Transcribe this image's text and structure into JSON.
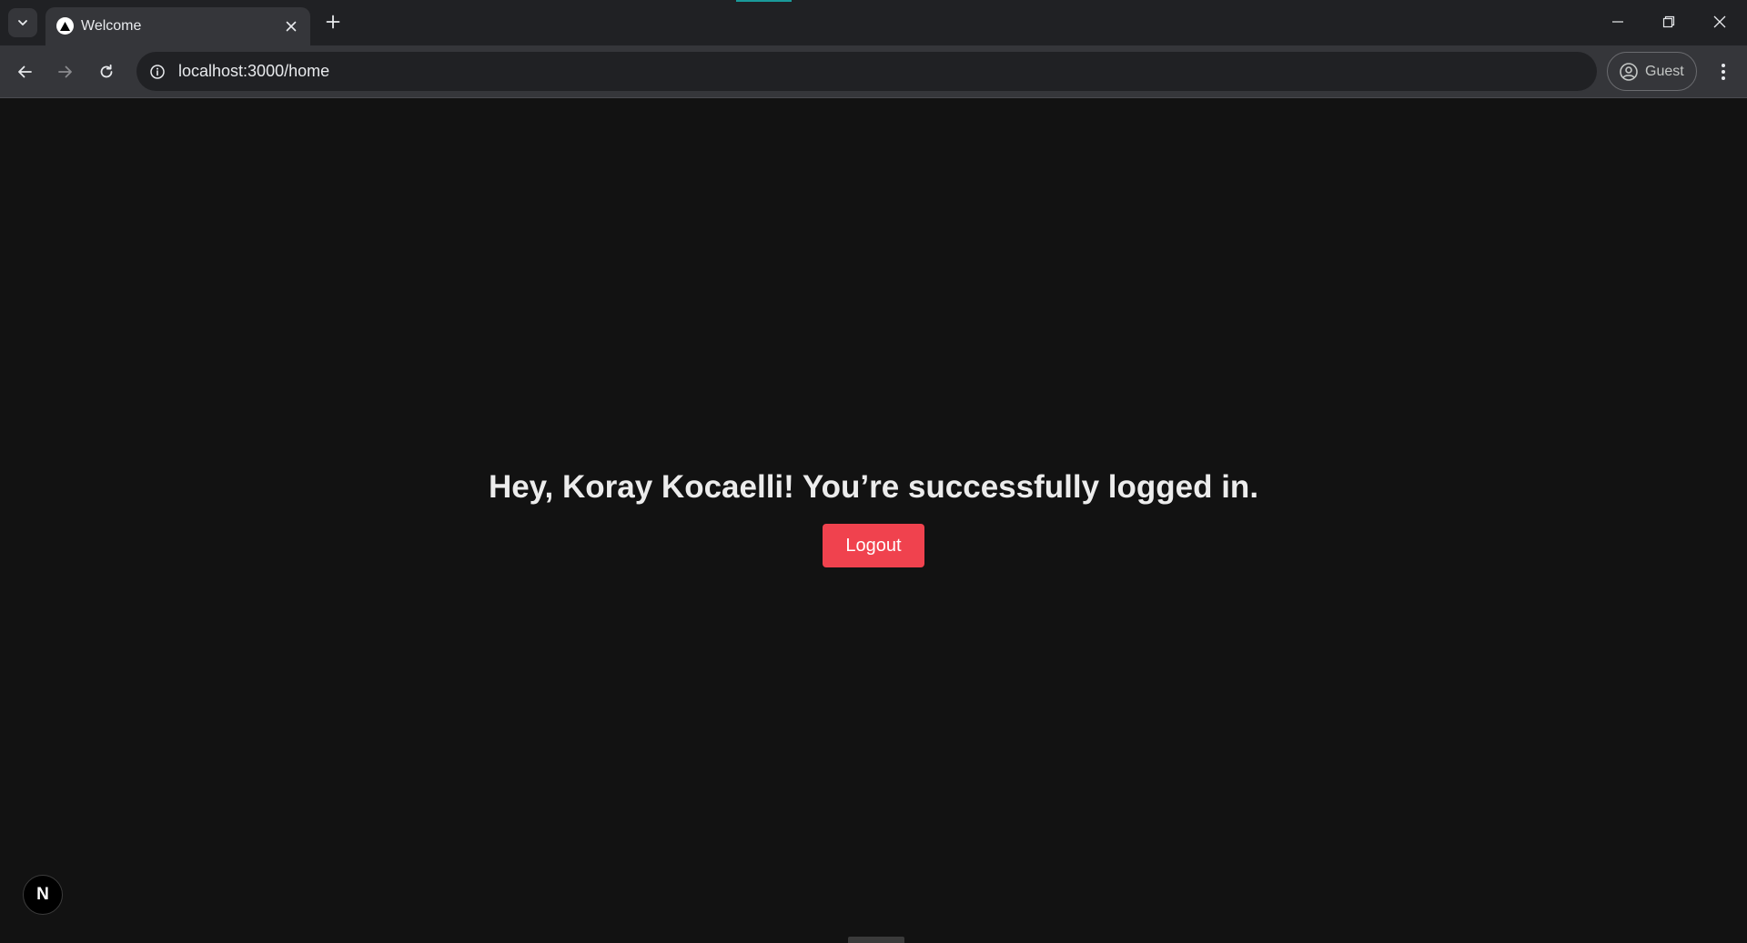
{
  "browser": {
    "tab": {
      "title": "Welcome",
      "favicon": "triangle-icon"
    },
    "address_bar": {
      "url": "localhost:3000/home"
    },
    "profile": {
      "label": "Guest"
    },
    "icons": {
      "tab_search": "chevron-down-icon",
      "tab_close": "close-icon",
      "new_tab": "plus-icon",
      "back": "arrow-left-icon",
      "forward": "arrow-right-icon",
      "reload": "reload-icon",
      "site_info": "info-icon",
      "profile": "user-circle-icon",
      "menu": "kebab-menu-icon",
      "minimize": "minimize-icon",
      "restore": "restore-icon",
      "close_window": "close-icon"
    }
  },
  "page": {
    "greeting": "Hey, Koray Kocaelli! You’re successfully logged in.",
    "logout_label": "Logout",
    "dev_badge": "N"
  },
  "colors": {
    "page_background": "#121212",
    "logout_button": "#f0424e",
    "tabstrip": "#202124",
    "toolbar": "#35363a"
  }
}
